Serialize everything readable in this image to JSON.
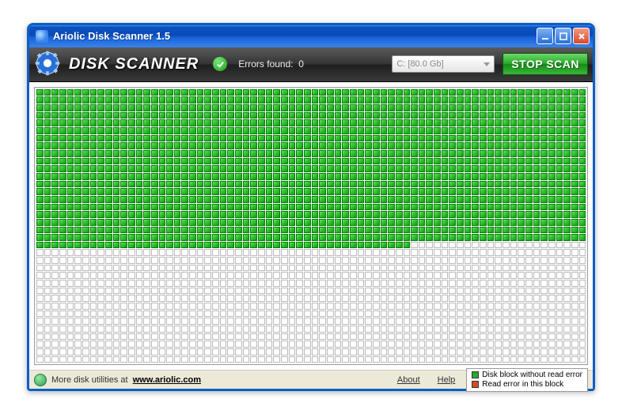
{
  "titlebar": {
    "text": "Ariolic Disk Scanner 1.5"
  },
  "toolbar": {
    "app_title": "DISK SCANNER",
    "errors_label": "Errors found:",
    "errors_count": "0",
    "drive_selected": "C: [80.0 Gb]",
    "stop_label": "STOP SCAN"
  },
  "grid": {
    "cols": 72,
    "rows": 36,
    "full_green_rows": 20,
    "partial_row_green_cols": 49
  },
  "statusbar": {
    "text": "More disk utilities at",
    "url_label": "www.ariolic.com",
    "about": "About",
    "help": "Help"
  },
  "legend": {
    "ok": "Disk block without read error",
    "err": "Read error in this block"
  }
}
